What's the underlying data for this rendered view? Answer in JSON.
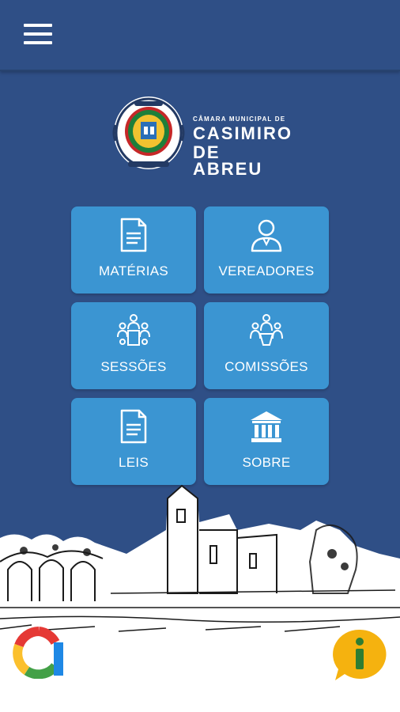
{
  "header": {
    "menu_icon": "hamburger-menu-icon"
  },
  "logo": {
    "small_text": "CÂMARA MUNICIPAL DE",
    "line1": "CASIMIRO",
    "line2": "DE ABREU"
  },
  "tiles": [
    {
      "label": "MATÉRIAS",
      "icon": "document-icon"
    },
    {
      "label": "VEREADORES",
      "icon": "person-icon"
    },
    {
      "label": "SESSÕES",
      "icon": "group-meeting-icon"
    },
    {
      "label": "COMISSÕES",
      "icon": "committee-icon"
    },
    {
      "label": "LEIS",
      "icon": "document-icon"
    },
    {
      "label": "SOBRE",
      "icon": "institution-building-icon"
    }
  ],
  "colors": {
    "background": "#2f4f86",
    "tile": "#3b95d2",
    "info_button": "#f5b20f"
  }
}
